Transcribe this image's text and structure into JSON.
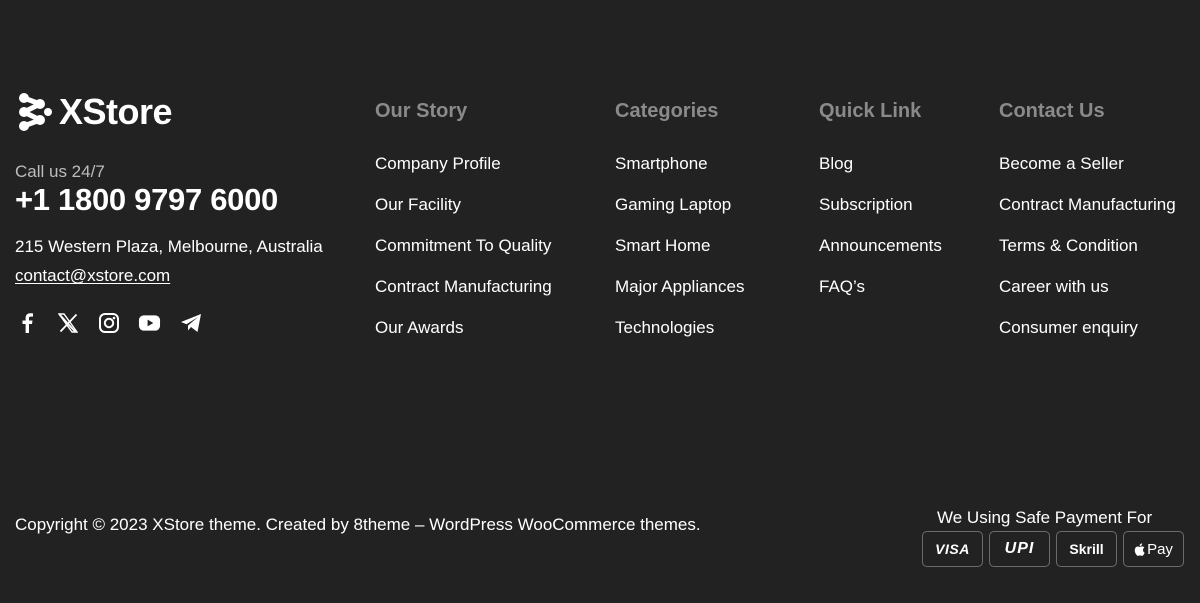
{
  "brand": {
    "logo_text": "XStore",
    "callus_label": "Call us 24/7",
    "phone": "+1 1800 9797 6000",
    "address": "215 Western Plaza, Melbourne, Australia",
    "email": "contact@xstore.com",
    "socials": [
      "facebook-icon",
      "x-twitter-icon",
      "instagram-icon",
      "youtube-icon",
      "telegram-icon"
    ]
  },
  "columns": {
    "story": {
      "title": "Our Story",
      "items": [
        "Company Profile",
        "Our Facility",
        "Commitment To Quality",
        "Contract Manufacturing",
        "Our Awards"
      ]
    },
    "categories": {
      "title": "Categories",
      "items": [
        "Smartphone",
        "Gaming Laptop",
        "Smart Home",
        "Major Appliances",
        "Technologies"
      ]
    },
    "quick": {
      "title": "Quick Link",
      "items": [
        "Blog",
        "Subscription",
        "Announcements",
        "FAQ’s"
      ]
    },
    "contact": {
      "title": "Contact Us",
      "items": [
        "Become a Seller",
        "Contract Manufacturing",
        "Terms & Condition",
        "Career with us",
        "Consumer enquiry"
      ]
    }
  },
  "bottom": {
    "copyright": "Copyright © 2023 XStore theme. Created by 8theme – WordPress WooCommerce themes.",
    "payment_title": "We Using Safe Payment For",
    "payments": [
      "VISA",
      "UPI",
      "Skrill",
      "Pay"
    ]
  },
  "colors": {
    "background": "#222222",
    "heading": "#8a8a8a",
    "text": "#ffffff",
    "muted": "#bdbdbd"
  }
}
